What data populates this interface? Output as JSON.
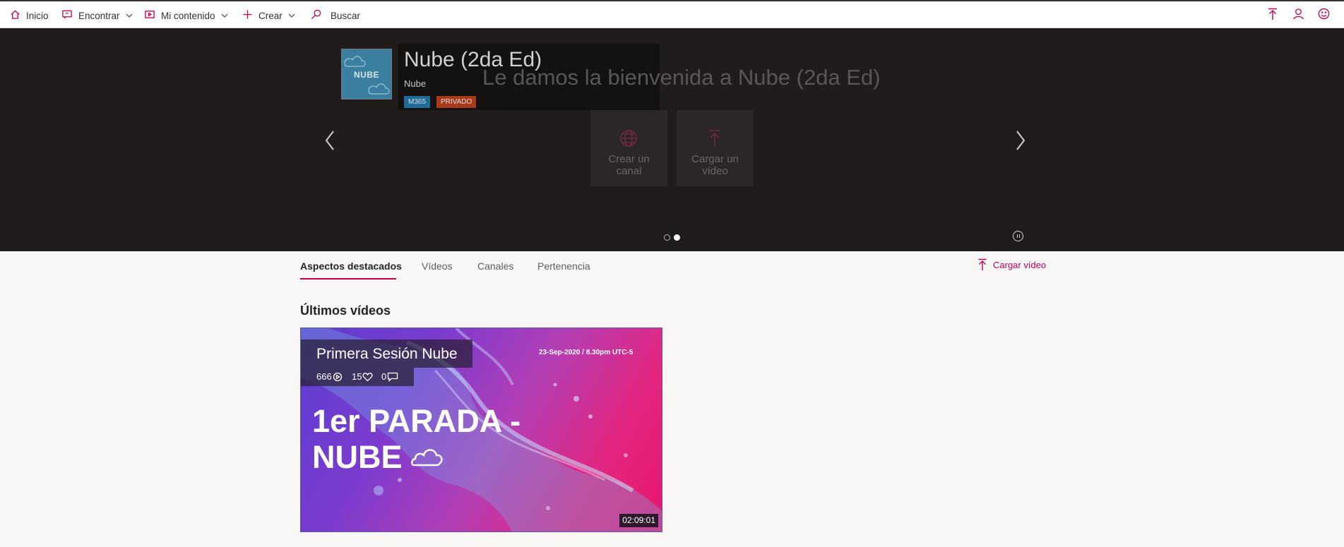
{
  "nav": {
    "home": "Inicio",
    "discover": "Encontrar",
    "my_content": "Mi contenido",
    "create": "Crear",
    "search_placeholder": "Buscar",
    "accent_color": "#c30052"
  },
  "hero": {
    "logo_text": "NUBE",
    "title": "Nube (2da Ed)",
    "subtitle": "Nube",
    "badges": [
      "M365",
      "PRIVADO"
    ],
    "welcome": "Le damos la bienvenida a Nube (2da Ed)",
    "actions": [
      {
        "line1": "Crear un",
        "line2": "canal",
        "icon": "globe-icon"
      },
      {
        "line1": "Cargar un",
        "line2": "vídeo",
        "icon": "upload-icon"
      }
    ],
    "carousel_slides": 2,
    "carousel_active": 2
  },
  "tabs": [
    "Aspectos destacados",
    "Vídeos",
    "Canales",
    "Pertenencia"
  ],
  "active_tab": "Aspectos destacados",
  "upload_label": "Cargar vídeo",
  "section_title": "Últimos vídeos",
  "video": {
    "title": "Primera Sesión Nube",
    "views": "666",
    "likes": "15",
    "comments": "0",
    "date": "23-Sep-2020 / 8.30pm UTC-5",
    "thumb_line1": "1er PARADA -",
    "thumb_line2": "NUBE",
    "duration": "02:09:01"
  }
}
